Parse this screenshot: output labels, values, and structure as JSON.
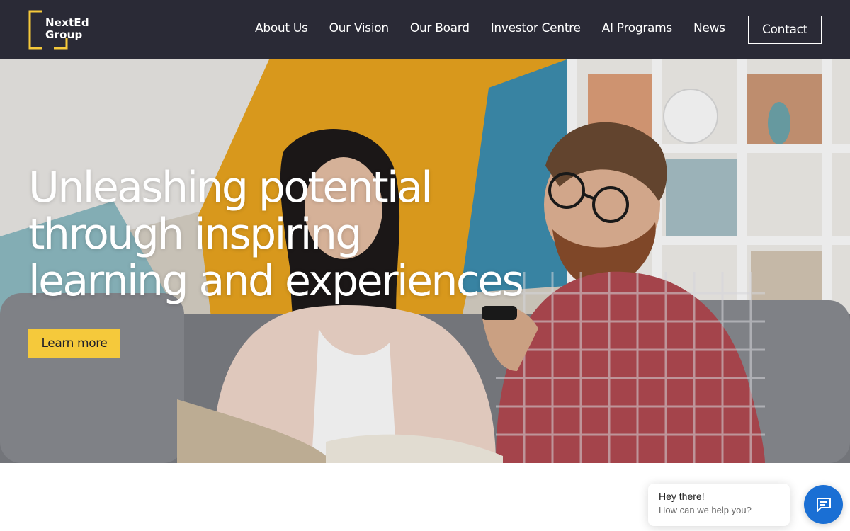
{
  "header": {
    "logo": {
      "line1": "NextEd",
      "line2": "Group"
    },
    "nav": [
      {
        "label": "About Us"
      },
      {
        "label": "Our Vision"
      },
      {
        "label": "Our Board"
      },
      {
        "label": "Investor Centre"
      },
      {
        "label": "AI Programs"
      },
      {
        "label": "News"
      }
    ],
    "contact_label": "Contact"
  },
  "hero": {
    "title_lines": [
      "Unleashing potential",
      "through inspiring",
      "learning and experiences"
    ],
    "cta_label": "Learn more"
  },
  "chat": {
    "greeting": "Hey there!",
    "prompt": "How can we help you?"
  },
  "colors": {
    "header_bg": "#2a2a36",
    "accent_yellow": "#f5c93b",
    "chat_blue": "#1a6fd4"
  },
  "icons": {
    "logo_frame": "bracket-frame-icon",
    "chat": "chat-icon"
  }
}
